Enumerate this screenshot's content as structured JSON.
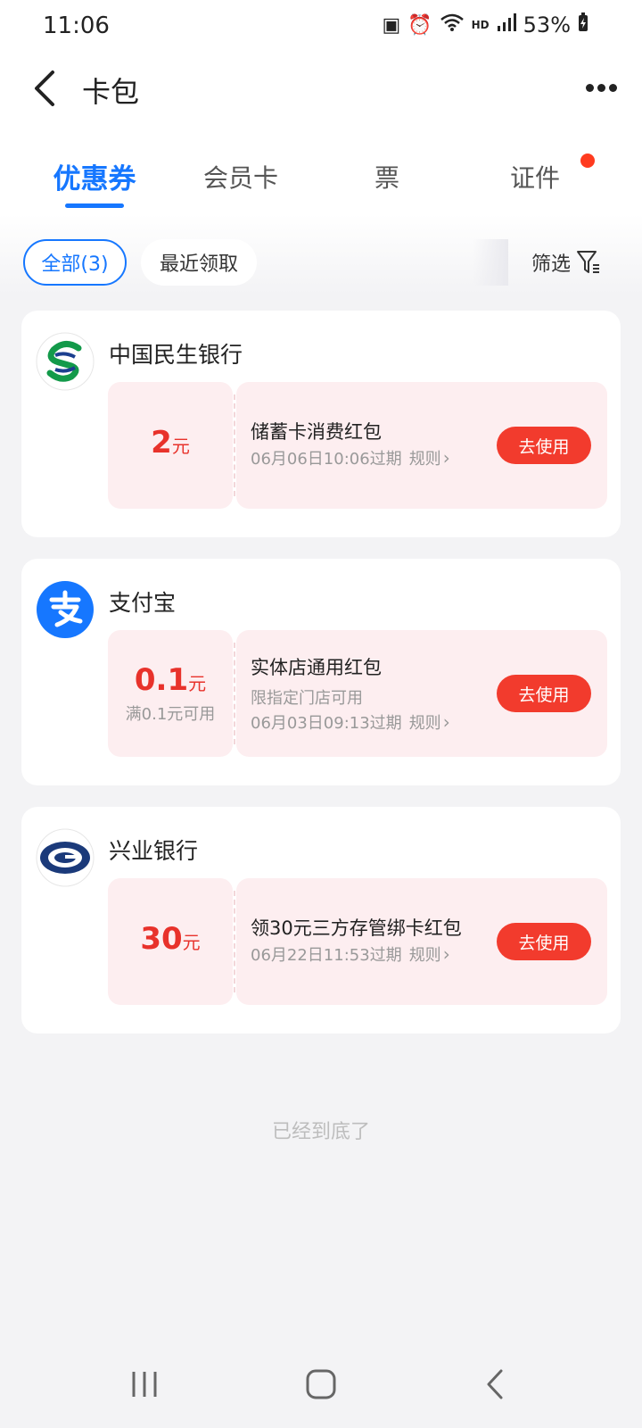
{
  "status_bar": {
    "time": "11:06",
    "network_label": "HD",
    "battery": "53%"
  },
  "header": {
    "title": "卡包"
  },
  "tabs": [
    {
      "label": "优惠券",
      "active": true
    },
    {
      "label": "会员卡",
      "active": false
    },
    {
      "label": "票",
      "active": false
    },
    {
      "label": "证件",
      "active": false,
      "badge_dot": true
    }
  ],
  "filters": {
    "all": "全部(3)",
    "recent": "最近领取",
    "filter": "筛选"
  },
  "cards": [
    {
      "issuer": "中国民生银行",
      "logo_icon": "cmbc-logo-icon",
      "amount": "2",
      "unit": "元",
      "condition": "",
      "title": "储蓄卡消费红包",
      "subtitle": "",
      "expire": "06月06日10:06过期",
      "rule": "规则",
      "action": "去使用"
    },
    {
      "issuer": "支付宝",
      "logo_icon": "alipay-logo-icon",
      "amount": "0.1",
      "unit": "元",
      "condition": "满0.1元可用",
      "title": "实体店通用红包",
      "subtitle": "限指定门店可用",
      "expire": "06月03日09:13过期",
      "rule": "规则",
      "action": "去使用"
    },
    {
      "issuer": "兴业银行",
      "logo_icon": "cib-logo-icon",
      "amount": "30",
      "unit": "元",
      "condition": "",
      "title": "领30元三方存管绑卡红包",
      "subtitle": "",
      "expire": "06月22日11:53过期",
      "rule": "规则",
      "action": "去使用"
    }
  ],
  "footer_text": "已经到底了",
  "colors": {
    "accent": "#1677ff",
    "price": "#e8322b",
    "button": "#f23b2d",
    "coupon_bg": "#fdeef0"
  }
}
